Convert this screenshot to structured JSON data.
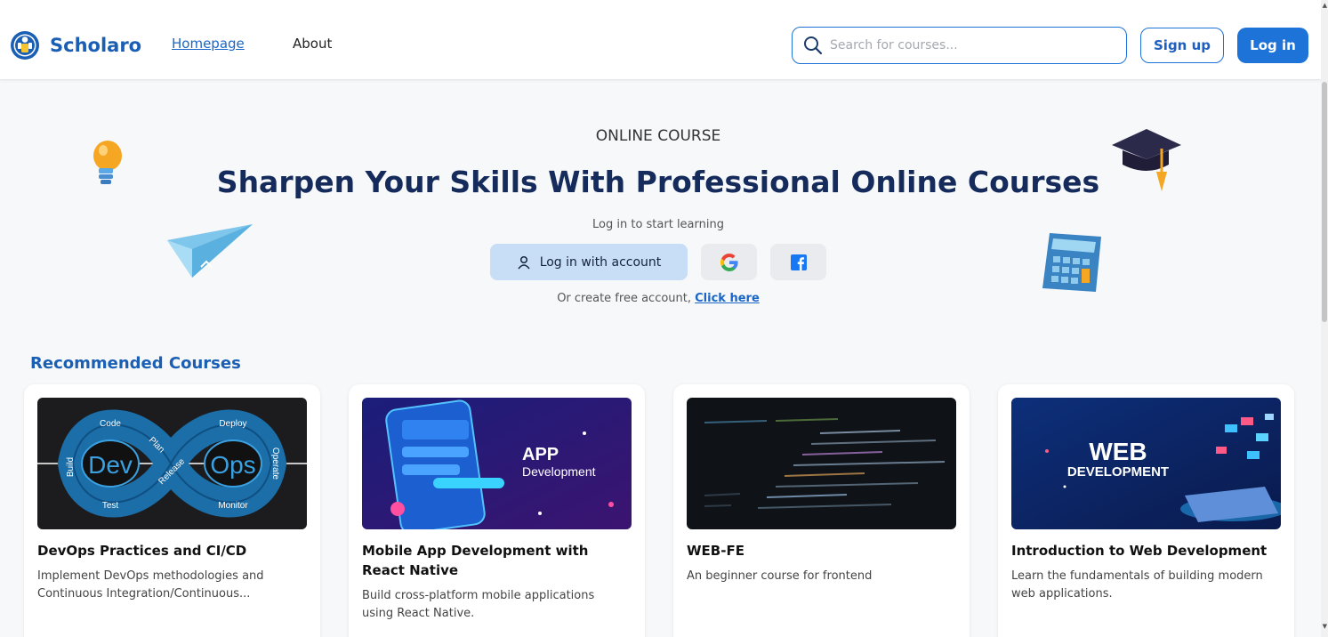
{
  "header": {
    "brand": "Scholaro",
    "nav": {
      "homepage": "Homepage",
      "about": "About"
    },
    "search_placeholder": "Search for courses...",
    "signup_label": "Sign up",
    "login_label": "Log in"
  },
  "hero": {
    "kicker": "ONLINE COURSE",
    "title": "Sharpen Your Skills With Professional Online Courses",
    "subtitle": "Log in to start learning",
    "account_button": "Log in with account",
    "create_prefix": "Or create free account, ",
    "create_link": "Click here"
  },
  "recommended": {
    "title": "Recommended Courses",
    "courses": [
      {
        "title": "DevOps Practices and CI/CD",
        "description": "Implement DevOps methodologies and Continuous Integration/Continuous...",
        "image": {
          "labels": [
            "Code",
            "Plan",
            "Build",
            "Dev",
            "Release",
            "Ops",
            "Deploy",
            "Operate",
            "Test",
            "Monitor"
          ]
        }
      },
      {
        "title": "Mobile App Development with React Native",
        "description": "Build cross-platform mobile applications using React Native.",
        "image": {
          "heading": "APP",
          "subheading": "Development"
        }
      },
      {
        "title": "WEB-FE",
        "description": "An beginner course for frontend"
      },
      {
        "title": "Introduction to Web Development",
        "description": "Learn the fundamentals of building modern web applications.",
        "image": {
          "heading": "WEB",
          "subheading": "DEVELOPMENT"
        }
      }
    ]
  },
  "colors": {
    "primary": "#1e73d8",
    "heading": "#142b5c",
    "background": "#f7f8fa"
  }
}
